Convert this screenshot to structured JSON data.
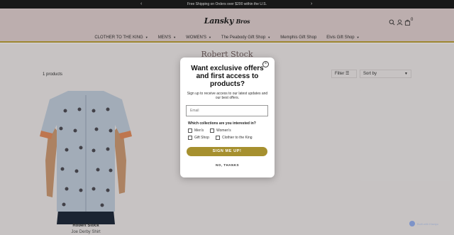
{
  "announcement": {
    "text": "Free Shipping on Orders over $200 within the U.S.",
    "prev": "‹",
    "next": "›"
  },
  "brand": {
    "logo_text": "Lansky",
    "logo_amp": "Bros"
  },
  "header": {
    "cart_count": "0"
  },
  "nav": [
    {
      "label": "CLOTHER TO THE KING",
      "has_menu": true
    },
    {
      "label": "MEN'S",
      "has_menu": true
    },
    {
      "label": "WOMEN'S",
      "has_menu": true
    },
    {
      "label": "The Peabody Gift Shop",
      "has_menu": true
    },
    {
      "label": "Memphis Gift Shop",
      "has_menu": false
    },
    {
      "label": "Elvis Gift Shop",
      "has_menu": true
    }
  ],
  "collection": {
    "title": "Robert Stock",
    "count": "1 products",
    "filter_label": "Filter",
    "sort_label": "Sort by"
  },
  "product": {
    "vendor": "Robert Stock",
    "name": "Joe Derby Shirt"
  },
  "modal": {
    "close": "×",
    "title": "Want exclusive offers and first access to products?",
    "subtitle": "Sign up to receive access to our latest updates and our best offers.",
    "email_placeholder": "Email",
    "question": "Which collections are you interested in?",
    "options": [
      "Men's",
      "Women's",
      "Gift Shop",
      "Clothier to the King"
    ],
    "signup": "SIGN ME UP!",
    "no_thanks": "NO, THANKS"
  },
  "badge": {
    "text": "Built with Klaviyo"
  },
  "colors": {
    "header_bg": "#d7c6c6",
    "accent": "#a6902f",
    "announce_bg": "#1c1c1c"
  }
}
